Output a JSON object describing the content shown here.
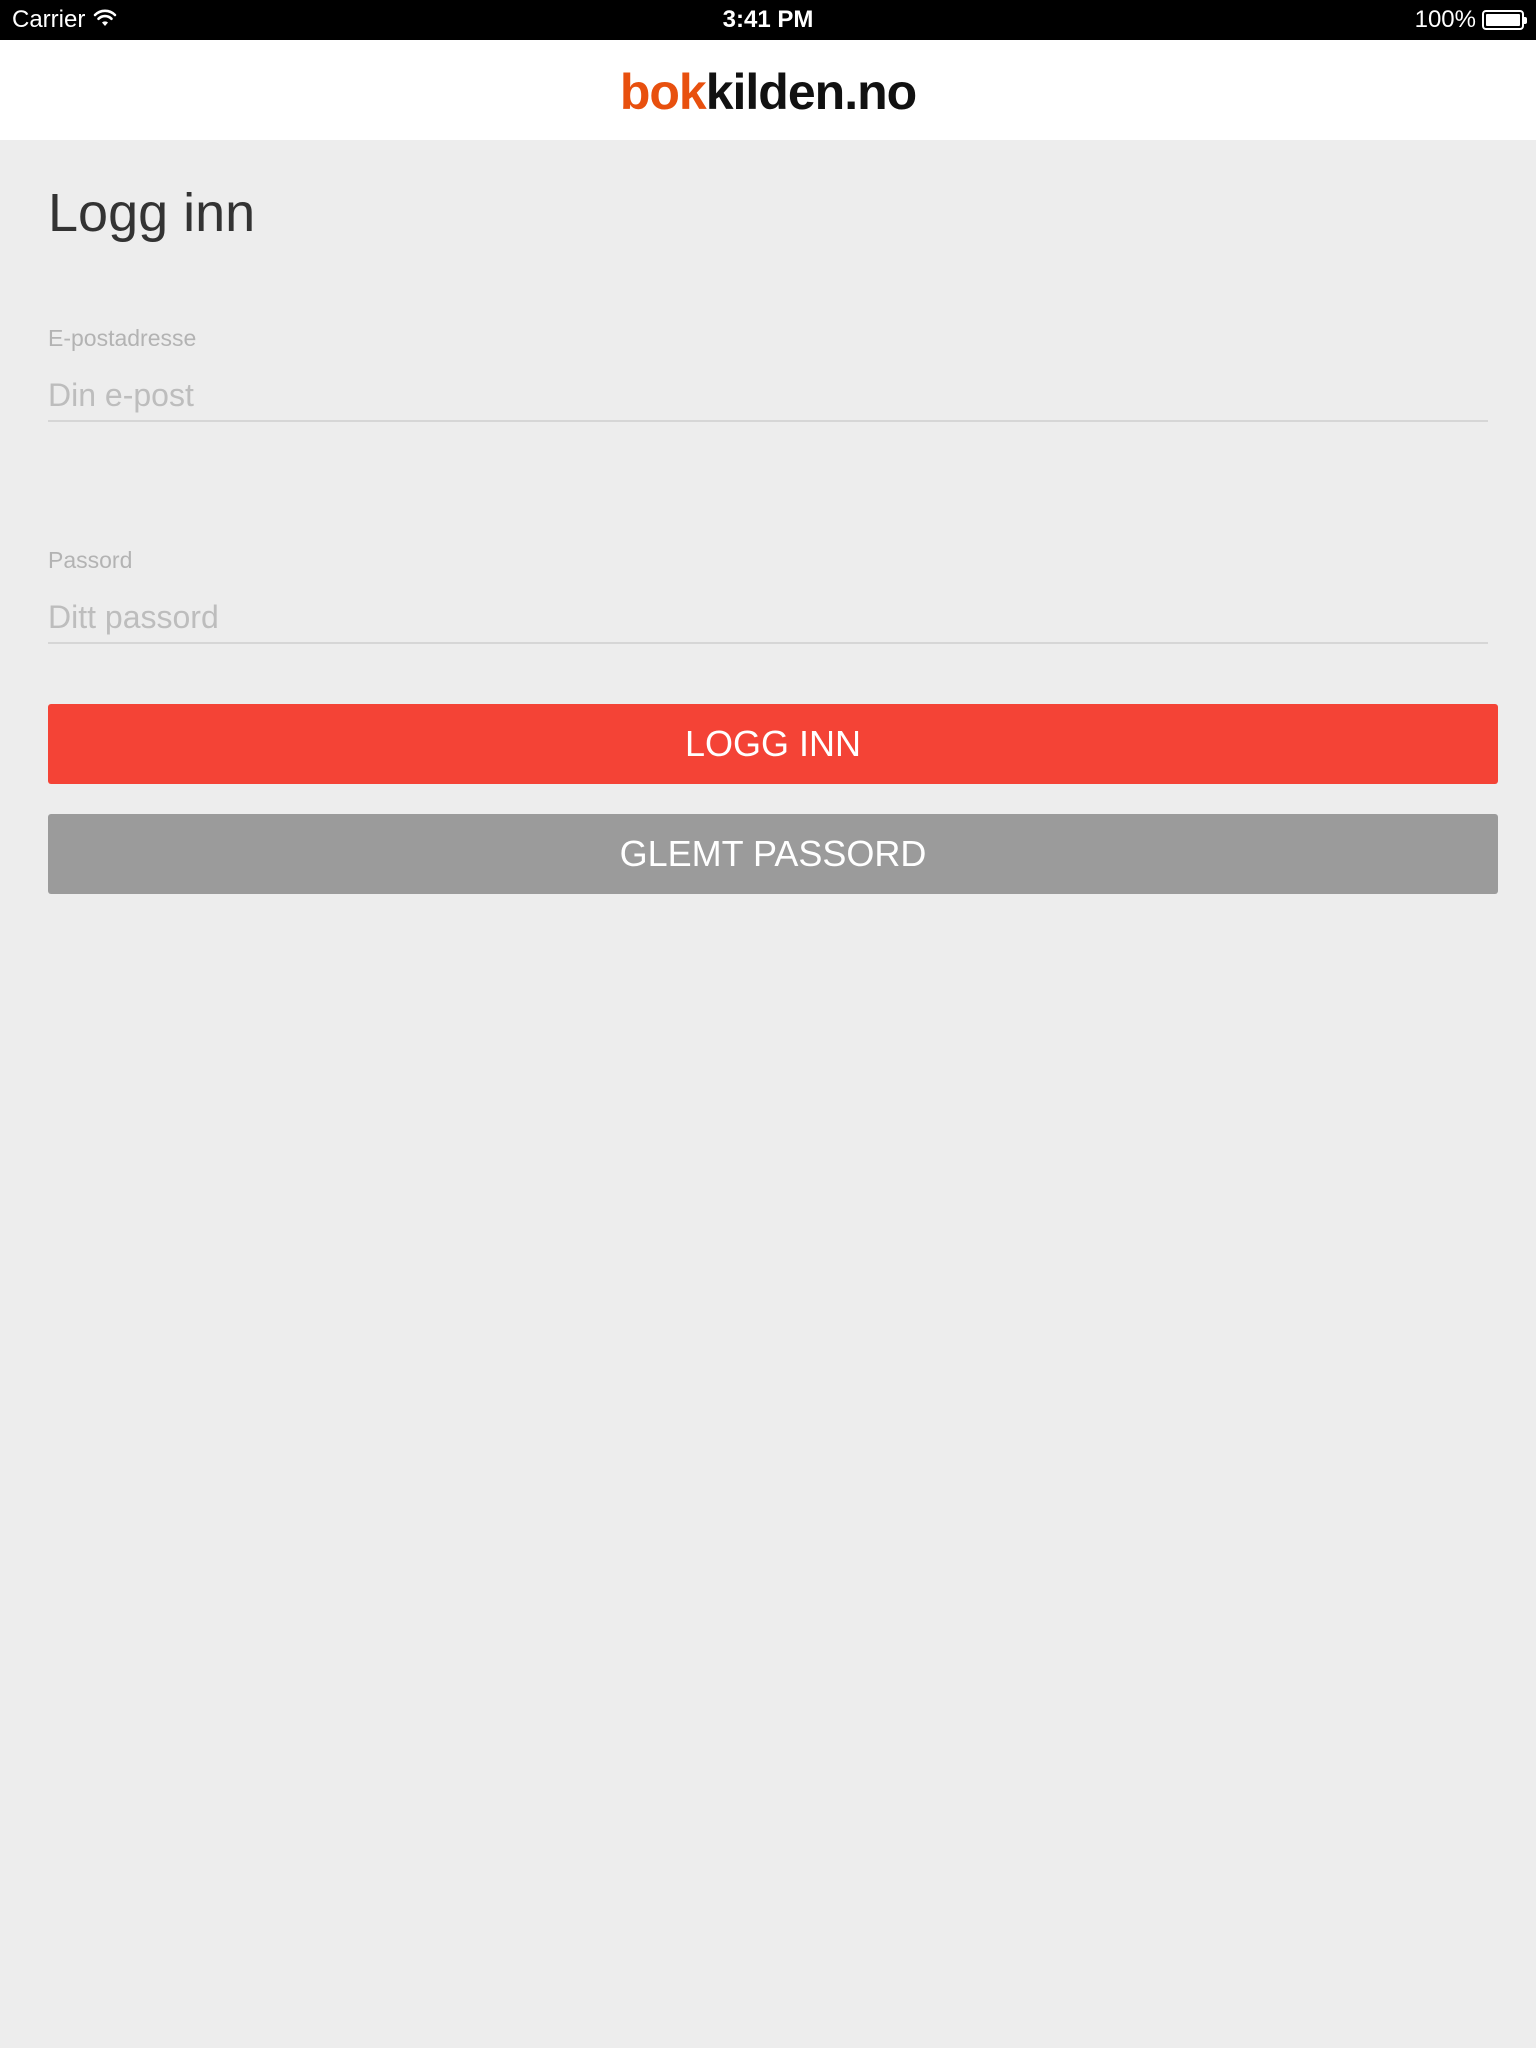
{
  "status_bar": {
    "carrier": "Carrier",
    "time": "3:41 PM",
    "battery": "100%"
  },
  "header": {
    "logo_part1": "bok",
    "logo_part2": "kilden.no"
  },
  "page": {
    "title": "Logg inn"
  },
  "form": {
    "email": {
      "label": "E-postadresse",
      "placeholder": "Din e-post",
      "value": ""
    },
    "password": {
      "label": "Passord",
      "placeholder": "Ditt passord",
      "value": ""
    },
    "login_label": "LOGG INN",
    "forgot_label": "GLEMT PASSORD"
  },
  "colors": {
    "brand_orange": "#e8500e",
    "login_button": "#f44336",
    "forgot_button": "#9b9b9b",
    "background": "#ededed"
  },
  "icons": {
    "wifi": "wifi-icon",
    "battery": "battery-icon"
  }
}
